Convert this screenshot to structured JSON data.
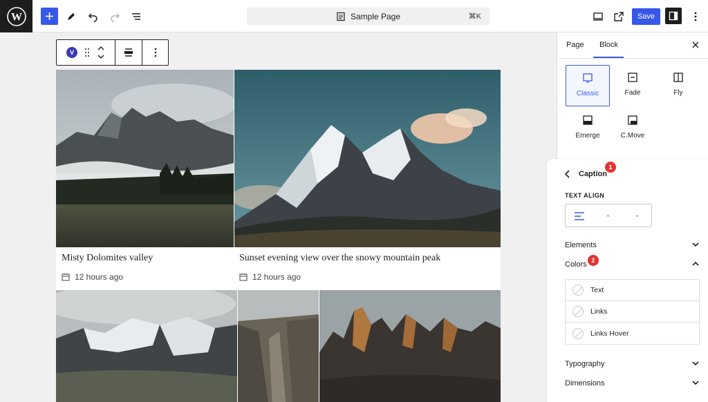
{
  "toolbar": {
    "document_title": "Sample Page",
    "shortcut": "⌘K",
    "save_label": "Save"
  },
  "block_toolbar": {
    "block_icon_letter": "V"
  },
  "gallery": {
    "items": [
      {
        "caption": "Misty Dolomites valley",
        "time": "12 hours ago"
      },
      {
        "caption": "Sunset evening view over the snowy mountain peak",
        "time": "12 hours ago"
      }
    ]
  },
  "sidebar": {
    "tabs": [
      "Page",
      "Block"
    ],
    "active_tab": "Block",
    "animations": [
      {
        "label": "Classic",
        "selected": true
      },
      {
        "label": "Fade",
        "selected": false
      },
      {
        "label": "Fly",
        "selected": false
      },
      {
        "label": "Emerge",
        "selected": false
      },
      {
        "label": "C.Move",
        "selected": false
      }
    ]
  },
  "caption_panel": {
    "title": "Caption",
    "badge_1": "1",
    "text_align_label": "TEXT ALIGN",
    "elements_label": "Elements",
    "colors_label": "Colors",
    "badge_2": "2",
    "colors": [
      "Text",
      "Links",
      "Links Hover"
    ],
    "typography_label": "Typography",
    "dimensions_label": "Dimensions"
  },
  "colors": {
    "accent": "#3858e9",
    "badge": "#e23434",
    "dark": "#1e1e1e"
  }
}
